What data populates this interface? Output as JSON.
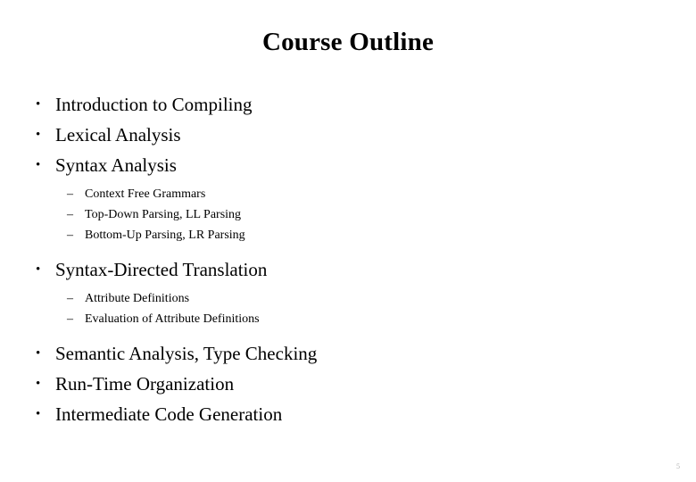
{
  "slide": {
    "title": "Course Outline",
    "page_number": "5",
    "bullet_marker": "•",
    "sub_bullet_marker": "–",
    "items": [
      {
        "label": "Introduction to Compiling",
        "children": []
      },
      {
        "label": "Lexical Analysis",
        "children": []
      },
      {
        "label": "Syntax Analysis",
        "children": [
          "Context Free Grammars",
          "Top-Down Parsing, LL Parsing",
          "Bottom-Up Parsing, LR Parsing"
        ]
      },
      {
        "label": "Syntax-Directed Translation",
        "children": [
          "Attribute Definitions",
          "Evaluation of Attribute Definitions"
        ]
      },
      {
        "label": "Semantic Analysis, Type Checking",
        "children": []
      },
      {
        "label": "Run-Time Organization",
        "children": []
      },
      {
        "label": "Intermediate Code Generation",
        "children": []
      }
    ]
  }
}
